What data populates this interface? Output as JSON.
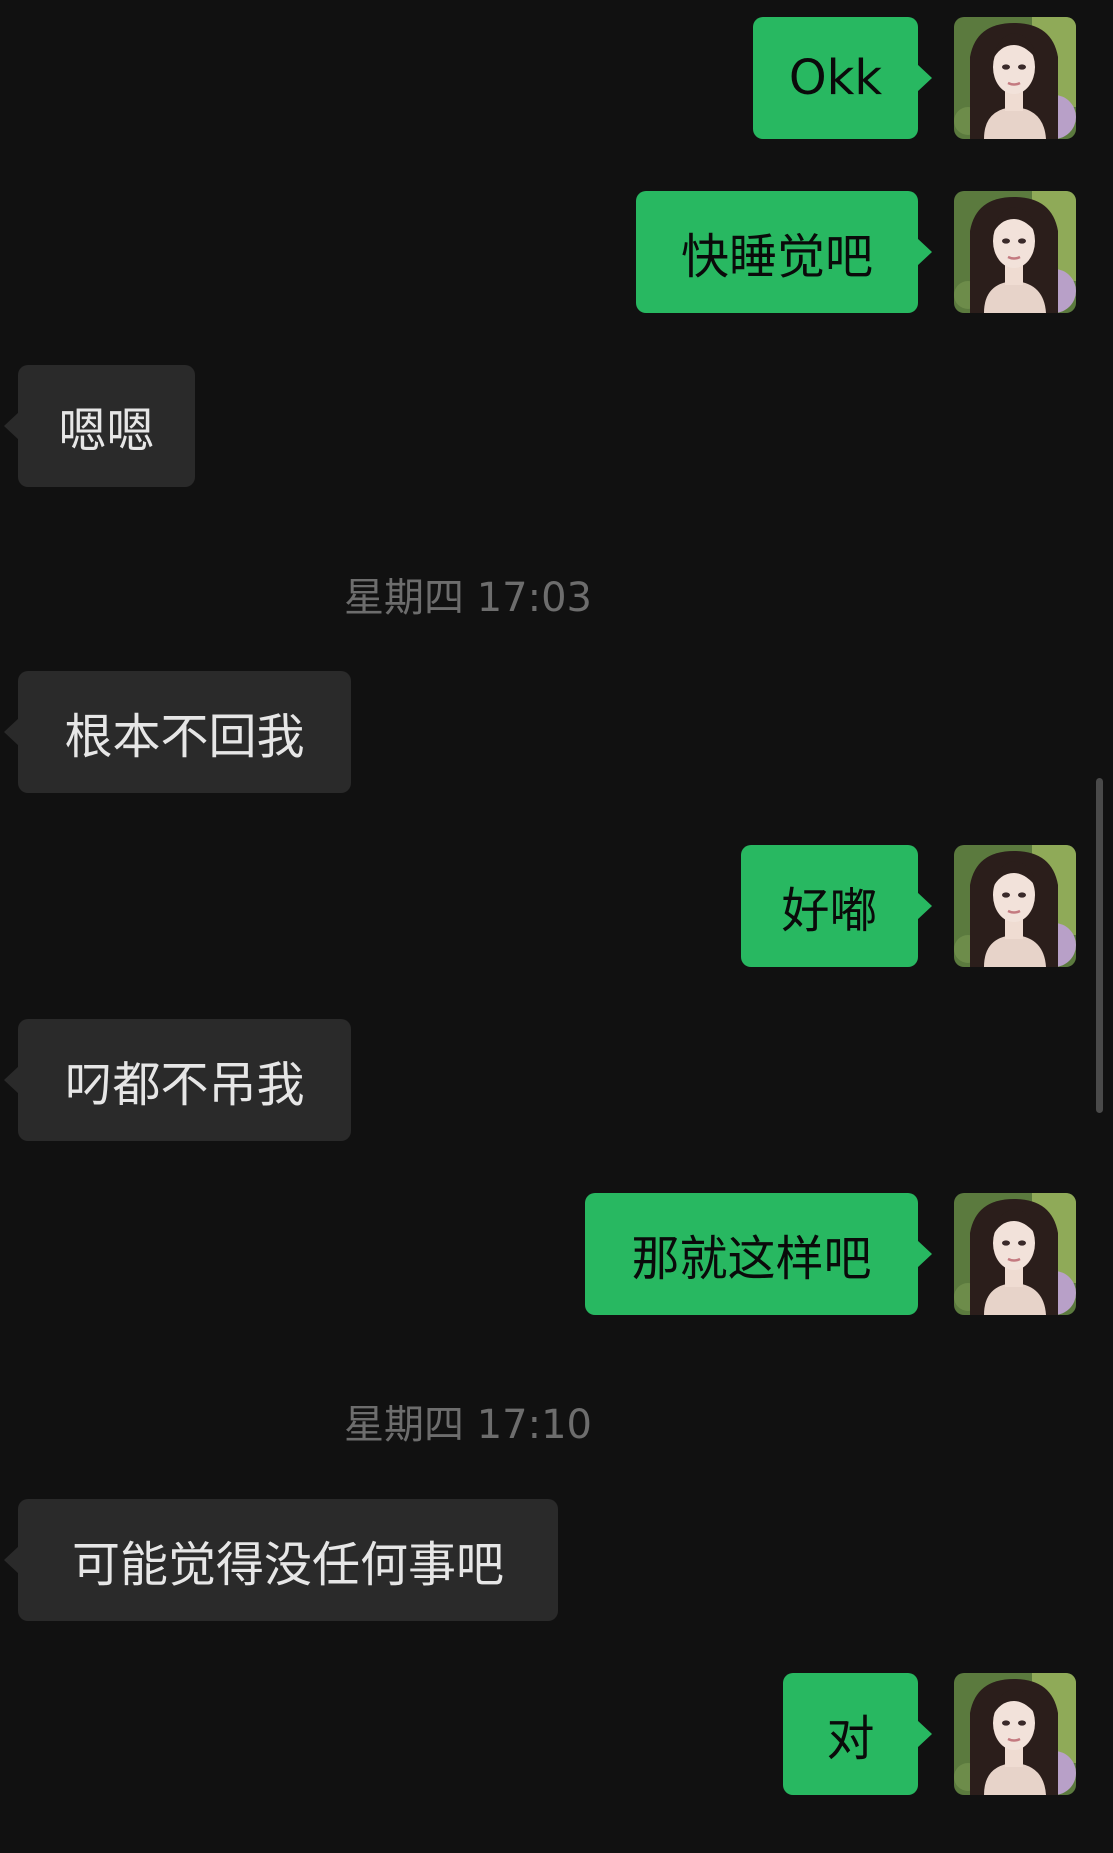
{
  "messages": [
    {
      "dir": "out",
      "text": "Okk"
    },
    {
      "dir": "out",
      "text": "快睡觉吧"
    },
    {
      "dir": "in",
      "text": "嗯嗯"
    },
    {
      "type": "time",
      "text": "星期四 17:03"
    },
    {
      "dir": "in",
      "text": "根本不回我"
    },
    {
      "dir": "out",
      "text": "好嘟"
    },
    {
      "dir": "in",
      "text": "叼都不吊我"
    },
    {
      "dir": "out",
      "text": "那就这样吧"
    },
    {
      "type": "time",
      "text": "星期四 17:10"
    },
    {
      "dir": "in",
      "text": "可能觉得没任何事吧"
    },
    {
      "dir": "out",
      "text": "对"
    }
  ],
  "colors": {
    "background": "#111111",
    "outgoing_bubble": "#28b861",
    "incoming_bubble": "#2a2a2a",
    "timestamp_text": "#6d6d6d"
  },
  "icons": {
    "avatar": "user-avatar-icon"
  }
}
